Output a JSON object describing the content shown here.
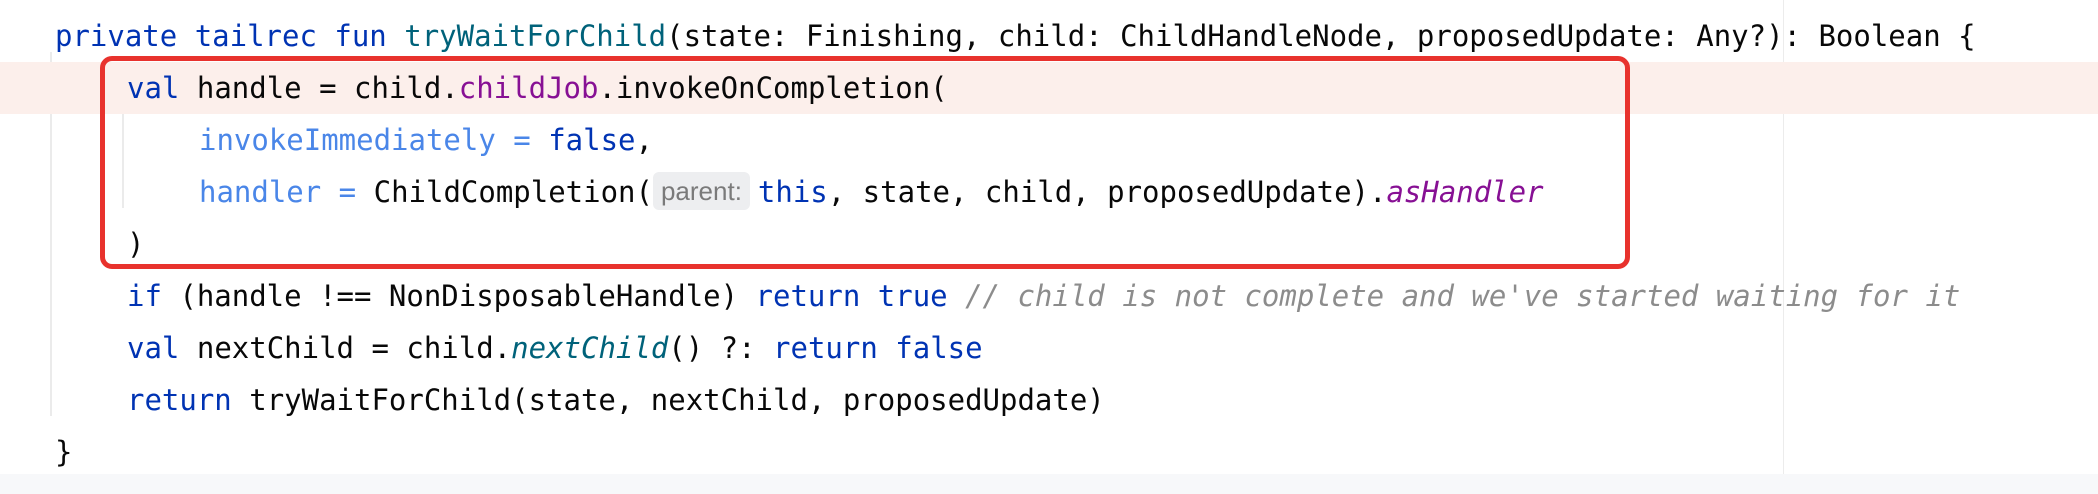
{
  "code": {
    "line1": {
      "kw_private": "private",
      "kw_tailrec": "tailrec",
      "kw_fun": "fun",
      "fn_name": "tryWaitForChild",
      "params": "(state: Finishing, child: ChildHandleNode, proposedUpdate: Any?): Boolean {"
    },
    "line2": {
      "kw_val": "val",
      "text1": "handle = child.",
      "prop": "childJob",
      "text2": ".invokeOnCompletion("
    },
    "line3": {
      "param": "invokeImmediately",
      "eq": " = ",
      "kw_false": "false",
      "comma": ","
    },
    "line4": {
      "param": "handler",
      "eq": " = ",
      "call": "ChildCompletion(",
      "hint": "parent:",
      "kw_this": "this",
      "args": ", state, child, proposedUpdate).",
      "ext": "asHandler"
    },
    "line5": {
      "close": ")"
    },
    "line6": {
      "kw_if": "if",
      "cond": " (handle !== NonDisposableHandle) ",
      "kw_return": "return",
      "kw_true": "true",
      "comment": "// child is not complete and we've started waiting for it"
    },
    "line7": {
      "kw_val": "val",
      "text1": "nextChild = child.",
      "fn": "nextChild",
      "text2": "() ?: ",
      "kw_return": "return",
      "kw_false": "false"
    },
    "line8": {
      "kw_return": "return",
      "call": "tryWaitForChild(state, nextChild, proposedUpdate)"
    },
    "line9": {
      "close": "}"
    }
  },
  "colors": {
    "keyword": "#0033b3",
    "function_declaration": "#00627a",
    "property": "#871094",
    "named_argument": "#4a86e8",
    "comment": "#8c8c8c",
    "highlight_border": "#e8322d",
    "current_line": "#fcefeb"
  }
}
